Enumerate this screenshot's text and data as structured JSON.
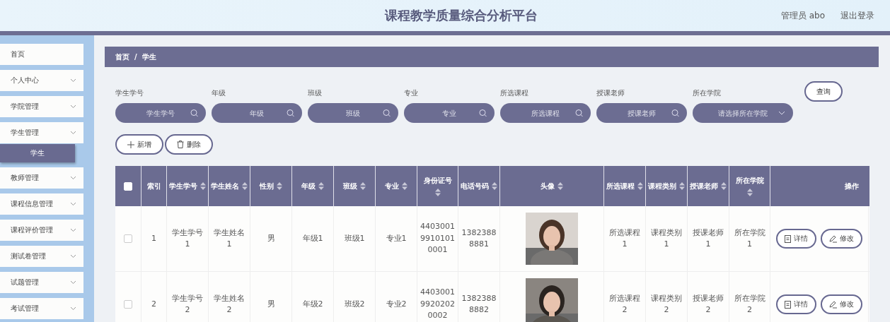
{
  "header": {
    "title": "课程教学质量综合分析平台",
    "user": "管理员 abo",
    "logout": "退出登录"
  },
  "sidebar": {
    "items": [
      {
        "label": "首页",
        "selected": false,
        "kind": "link"
      },
      {
        "label": "个人中心",
        "selected": false,
        "kind": "menu"
      },
      {
        "label": "学院管理",
        "selected": false,
        "kind": "menu"
      },
      {
        "label": "学生管理",
        "selected": false,
        "kind": "menu",
        "children": [
          {
            "label": "学生",
            "selected": true
          }
        ]
      },
      {
        "label": "教师管理",
        "selected": false,
        "kind": "menu"
      },
      {
        "label": "课程信息管理",
        "selected": false,
        "kind": "menu"
      },
      {
        "label": "课程评价管理",
        "selected": false,
        "kind": "menu"
      },
      {
        "label": "测试卷管理",
        "selected": false,
        "kind": "menu"
      },
      {
        "label": "试题管理",
        "selected": false,
        "kind": "menu"
      },
      {
        "label": "考试管理",
        "selected": false,
        "kind": "menu"
      }
    ]
  },
  "breadcrumb": [
    "首页",
    "学生"
  ],
  "breadcrumb_separator": "/",
  "filters": [
    {
      "label": "学生学号",
      "placeholder": "学生学号",
      "kind": "search"
    },
    {
      "label": "年级",
      "placeholder": "年级",
      "kind": "search"
    },
    {
      "label": "班级",
      "placeholder": "班级",
      "kind": "search"
    },
    {
      "label": "专业",
      "placeholder": "专业",
      "kind": "search"
    },
    {
      "label": "所选课程",
      "placeholder": "所选课程",
      "kind": "search"
    },
    {
      "label": "授课老师",
      "placeholder": "授课老师",
      "kind": "search"
    },
    {
      "label": "所在学院",
      "placeholder": "请选择所在学院",
      "kind": "select"
    }
  ],
  "query_button": "查询",
  "actions": [
    {
      "label": "新增",
      "kind": "add"
    },
    {
      "label": "删除",
      "kind": "delete"
    }
  ],
  "table": {
    "columns": [
      {
        "kind": "checkbox",
        "checked": false
      },
      {
        "label": "索引",
        "kind": "plain"
      },
      {
        "label": "学生学号",
        "kind": "sort"
      },
      {
        "label": "学生姓名",
        "kind": "sort"
      },
      {
        "label": "性别",
        "kind": "sort"
      },
      {
        "label": "年级",
        "kind": "sort"
      },
      {
        "label": "班级",
        "kind": "sort"
      },
      {
        "label": "专业",
        "kind": "sort"
      },
      {
        "label": "身份证号",
        "kind": "sort"
      },
      {
        "label": "电话号码",
        "kind": "sort"
      },
      {
        "label": "头像",
        "kind": "sort"
      },
      {
        "label": "所选课程",
        "kind": "sort"
      },
      {
        "label": "课程类别",
        "kind": "sort"
      },
      {
        "label": "授课老师",
        "kind": "sort"
      },
      {
        "label": "所在学院",
        "kind": "sort"
      },
      {
        "label": "操作",
        "kind": "actions"
      }
    ],
    "rows": [
      {
        "cells": [
          {
            "kind": "checkbox",
            "checked": false
          },
          {
            "kind": "text",
            "text": "1"
          },
          {
            "kind": "text",
            "text": "学生学号1"
          },
          {
            "kind": "text",
            "text": "学生姓名1"
          },
          {
            "kind": "text",
            "text": "男"
          },
          {
            "kind": "text",
            "text": "年级1"
          },
          {
            "kind": "text",
            "text": "班级1"
          },
          {
            "kind": "text",
            "text": "专业1"
          },
          {
            "kind": "text",
            "text": "440300199101010001"
          },
          {
            "kind": "text",
            "text": "13823888881"
          },
          {
            "kind": "picture"
          },
          {
            "kind": "text",
            "text": "所选课程1"
          },
          {
            "kind": "text",
            "text": "课程类别1"
          },
          {
            "kind": "text",
            "text": "授课老师1"
          },
          {
            "kind": "text",
            "text": "所在学院1"
          },
          {
            "kind": "actions",
            "buttons": [
              {
                "label": "详情",
                "kind": "detail"
              },
              {
                "label": "修改",
                "kind": "edit"
              }
            ]
          }
        ]
      },
      {
        "cells": [
          {
            "kind": "checkbox",
            "checked": false
          },
          {
            "kind": "text",
            "text": "2"
          },
          {
            "kind": "text",
            "text": "学生学号2"
          },
          {
            "kind": "text",
            "text": "学生姓名2"
          },
          {
            "kind": "text",
            "text": "男"
          },
          {
            "kind": "text",
            "text": "年级2"
          },
          {
            "kind": "text",
            "text": "班级2"
          },
          {
            "kind": "text",
            "text": "专业2"
          },
          {
            "kind": "text",
            "text": "440300199202020002"
          },
          {
            "kind": "text",
            "text": "13823888882"
          },
          {
            "kind": "picture"
          },
          {
            "kind": "text",
            "text": "所选课程2"
          },
          {
            "kind": "text",
            "text": "课程类别2"
          },
          {
            "kind": "text",
            "text": "授课老师2"
          },
          {
            "kind": "text",
            "text": "所在学院2"
          },
          {
            "kind": "actions",
            "buttons": [
              {
                "label": "详情",
                "kind": "detail"
              },
              {
                "label": "修改",
                "kind": "edit"
              }
            ]
          }
        ]
      }
    ]
  }
}
